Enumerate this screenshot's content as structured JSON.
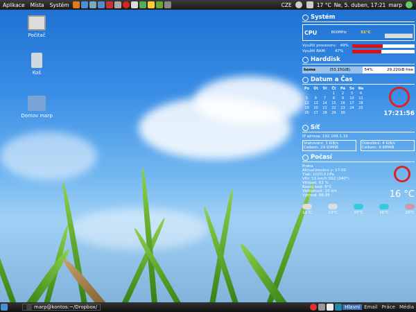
{
  "topbar": {
    "menus": [
      "Aplikace",
      "Místa",
      "Systém"
    ],
    "keyboard": "CZE",
    "temp": "17 °C",
    "datetime": "Ne,  5. duben, 17:21",
    "user": "marp"
  },
  "desktop": {
    "icons": [
      "Počítač",
      "Koš",
      "Domov marp"
    ]
  },
  "conky": {
    "system": {
      "title": "Systém",
      "cpu_label": "CPU",
      "cpu_freq": "800MHz",
      "cpu_temp": "51°C",
      "cpu_usage_label": "Využití procesoru:",
      "cpu_usage": "49%",
      "cpu_fill": 0.49,
      "ram_usage_label": "Využití RAM:",
      "ram_usage": "47%",
      "ram_fill": 0.47
    },
    "hdd": {
      "title": "Harddisk",
      "name": "home",
      "size": "(53.15GiB)",
      "pct": "54%",
      "free": "29.22GiB free",
      "fill": 0.54
    },
    "datetime": {
      "title": "Datum a Čas",
      "time": "17:21:56",
      "days": [
        "Po",
        "Út",
        "St",
        "Čt",
        "Pá",
        "So",
        "Ne"
      ],
      "dates": [
        "",
        "",
        "",
        "1",
        "2",
        "3",
        "4",
        "5",
        "6",
        "7",
        "8",
        "9",
        "10",
        "11",
        "12",
        "13",
        "14",
        "15",
        "16",
        "17",
        "18",
        "19",
        "20",
        "21",
        "22",
        "23",
        "24",
        "25",
        "26",
        "27",
        "28",
        "29",
        "30"
      ]
    },
    "net": {
      "title": "Síť",
      "ip": "IP adresa: 192.168.1.10",
      "down": "Stahování:  3  KiB/s",
      "down_total": "Celkem: 29.93MiB",
      "up": "Odesílání: 4 KiB/s",
      "up_total": "Celkem: 4.98MiB"
    },
    "weather": {
      "title": "Počasí",
      "place": "Praha",
      "lines": [
        "Aktualizováno v: 17:00",
        "Tlak: 1020.0 hPa",
        "Vítr: 13 km/h  SSZ (340°)",
        "Vlhkost: 63 %",
        "Rosný bod: 9°C",
        "Viditelnost: 10 km",
        "Východ: 06:35"
      ],
      "temp": "16 °C",
      "forecast": [
        "11°C",
        "13°C",
        "15°C",
        "16°C",
        "19°C"
      ]
    }
  },
  "bottombar": {
    "task": "marp@kontos:~/Dropbox/",
    "workspaces": [
      "Hlavní",
      "Email",
      "Práce",
      "Média"
    ]
  }
}
